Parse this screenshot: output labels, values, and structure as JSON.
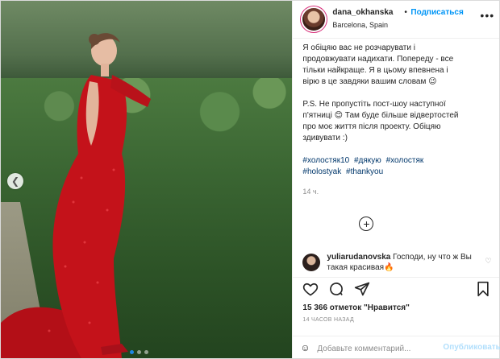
{
  "post": {
    "user": {
      "username": "dana_okhanska",
      "separator": "•",
      "follow_label": "Подписаться",
      "location": "Barcelona, Spain",
      "more_icon": "more-horizontal-icon"
    },
    "caption": {
      "paragraph1": "Я обіцяю вас не розчарувати і продовжувати надихати. Попереду - все тільки найкраще. Я в цьому впевнена і вірю в це завдяки вашим словам 😉",
      "paragraph2": "P.S. Не пропустіть пост-шоу наступної п'ятниці 😊 Там буде більше відвертостей про моє життя після проекту. Обіцяю здивувати :)",
      "hashtags": [
        "#холостяк10",
        "#дякую",
        "#холостяк",
        "#holostyak",
        "#thankyou"
      ],
      "time": "14 ч."
    },
    "load_more_label": "+",
    "comment": {
      "username": "yuliarudanovska",
      "text": "Господи, ну что ж Вы такая красивая🔥"
    },
    "likes_text": "15 366 отметок \"Нравится\"",
    "time_ago": "14 ЧАСОВ НАЗАД",
    "comment_input": {
      "placeholder": "Добавьте комментарий...",
      "publish_label": "Опубликовать"
    },
    "icons": {
      "like": "heart-icon",
      "comment": "comment-icon",
      "share": "share-icon",
      "save": "bookmark-icon"
    },
    "carousel": {
      "slides": 3,
      "active": 1
    },
    "colors": {
      "link_blue": "#0095f6",
      "hashtag": "#00376b",
      "muted": "#8e8e8e",
      "dress_red": "#c4121a"
    }
  }
}
